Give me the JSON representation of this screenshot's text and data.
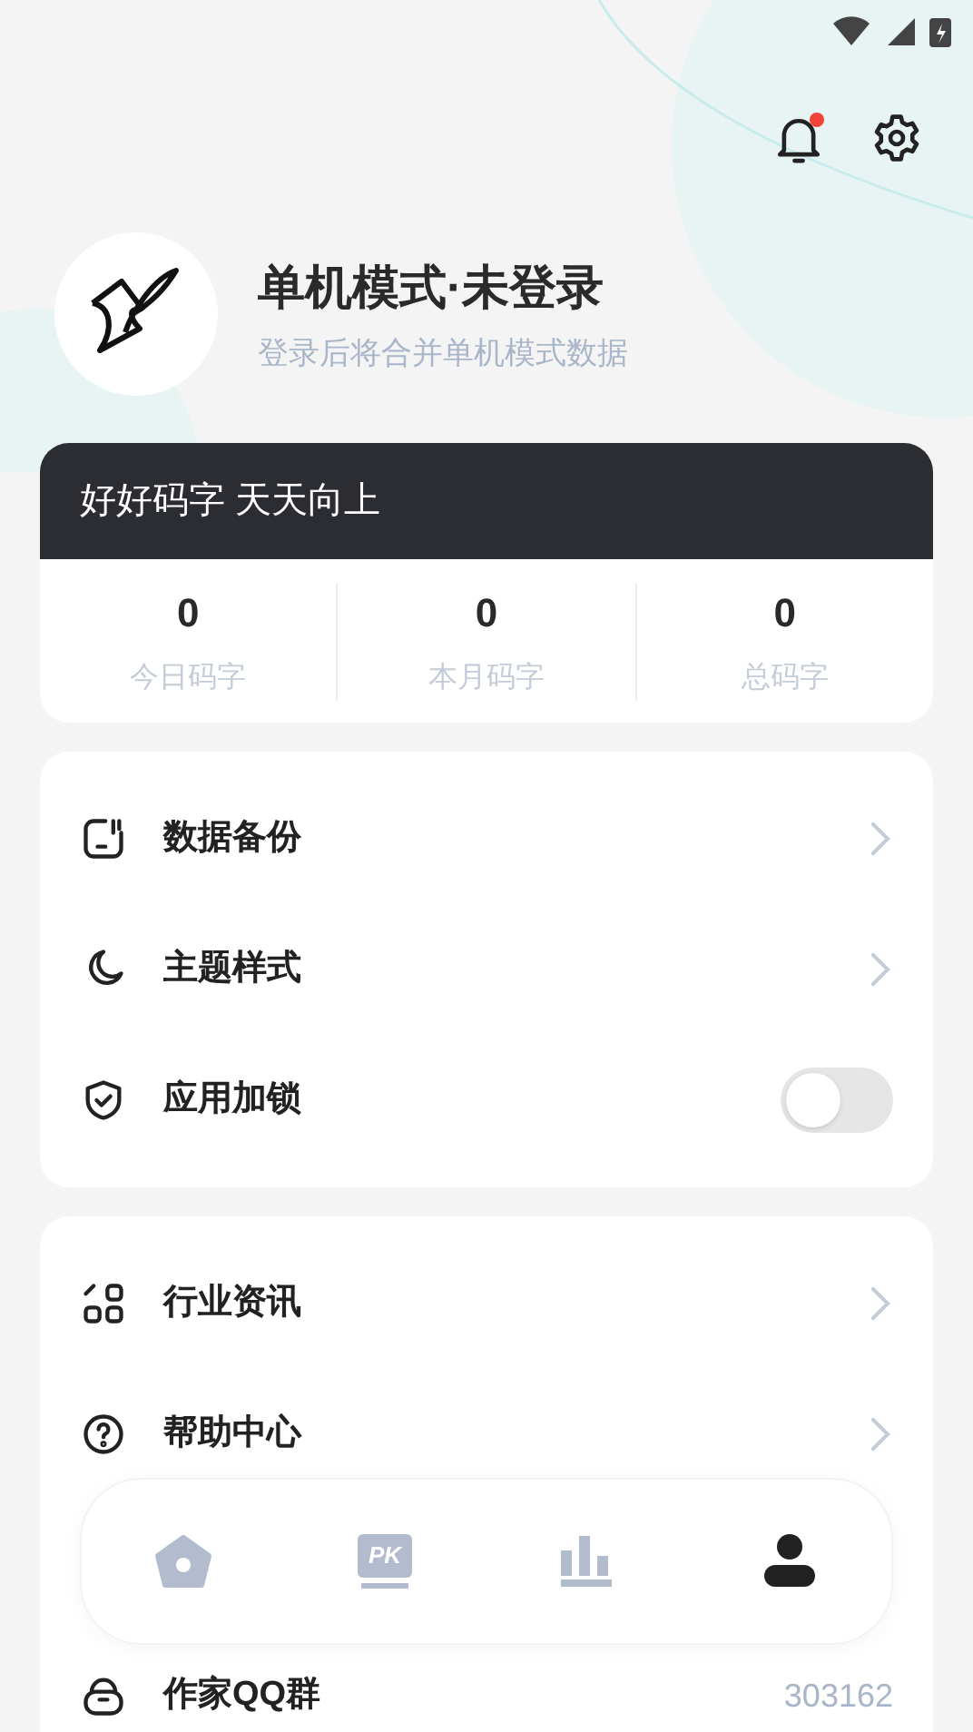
{
  "header": {
    "notification_unread": true
  },
  "profile": {
    "name": "单机模式·未登录",
    "subtitle": "登录后将合并单机模式数据"
  },
  "stats_card": {
    "slogan": "好好码字 天天向上",
    "stats": [
      {
        "value": "0",
        "label": "今日码字"
      },
      {
        "value": "0",
        "label": "本月码字"
      },
      {
        "value": "0",
        "label": "总码字"
      }
    ]
  },
  "settings": [
    {
      "kind": "link",
      "label": "数据备份"
    },
    {
      "kind": "link",
      "label": "主题样式"
    },
    {
      "kind": "toggle",
      "label": "应用加锁",
      "on": false
    }
  ],
  "more": [
    {
      "kind": "link",
      "label": "行业资讯"
    },
    {
      "kind": "link",
      "label": "帮助中心"
    },
    {
      "kind": "value",
      "label": "作家QQ群",
      "value": "303162"
    }
  ],
  "bottom_nav": [
    {
      "selected": false
    },
    {
      "icon_text": "PK",
      "selected": false
    },
    {
      "selected": false
    },
    {
      "selected": true
    }
  ]
}
